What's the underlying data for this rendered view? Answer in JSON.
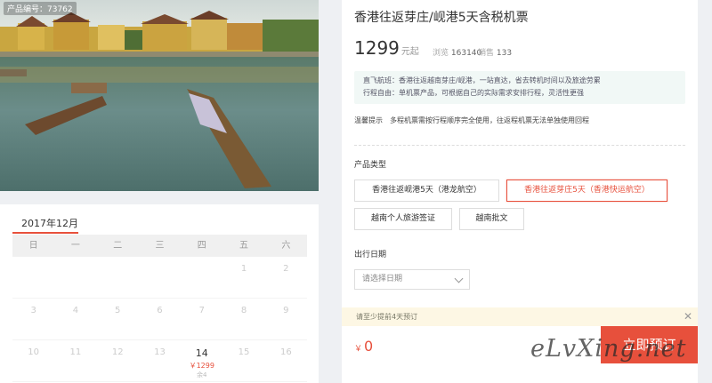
{
  "photo": {
    "id_label": "产品编号：73762"
  },
  "calendar": {
    "month": "2017年12月",
    "weekdays": [
      "日",
      "一",
      "二",
      "三",
      "四",
      "五",
      "六"
    ],
    "rows": [
      [
        "",
        "",
        "",
        "",
        "",
        "1",
        "2"
      ],
      [
        "3",
        "4",
        "5",
        "6",
        "7",
        "8",
        "9"
      ],
      [
        "10",
        "11",
        "12",
        "13",
        "14",
        "15",
        "16"
      ]
    ],
    "active_day": {
      "day": "14",
      "price": "￥1299",
      "stock": "余4"
    }
  },
  "product": {
    "title": "香港往返芽庄/岘港5天含税机票",
    "price": "1299",
    "price_unit": "元起",
    "views_label": "浏览",
    "views": "163140",
    "sales_label": "销售",
    "sales": "133",
    "info_lines": [
      "直飞航班：香港往返越南芽庄/岘港，一站直达，省去转机时间以及旅途劳累",
      "行程自由：单机票产品，可根据自己的实际需求安排行程，灵活性更强"
    ],
    "tip_label": "温馨提示",
    "tip_text": "多程机票需按行程顺序完全使用，往返程机票无法单独使用回程"
  },
  "options": {
    "label": "产品类型",
    "items": [
      "香港往返岘港5天（港龙航空）",
      "香港往返芽庄5天（香港快运航空）",
      "越南个人旅游签证",
      "越南批文"
    ],
    "selected_index": 1
  },
  "date": {
    "label": "出行日期",
    "placeholder": "请选择日期"
  },
  "notice": {
    "text": "请至少提前4天预订",
    "close": "✕"
  },
  "booking": {
    "currency": "￥",
    "total": "0",
    "button": "立即预订"
  },
  "watermark": "eLvXing.net",
  "colors": {
    "accent": "#e7503c",
    "info_bg": "#f1f8f6",
    "notice_bg": "#fdf7e4"
  }
}
